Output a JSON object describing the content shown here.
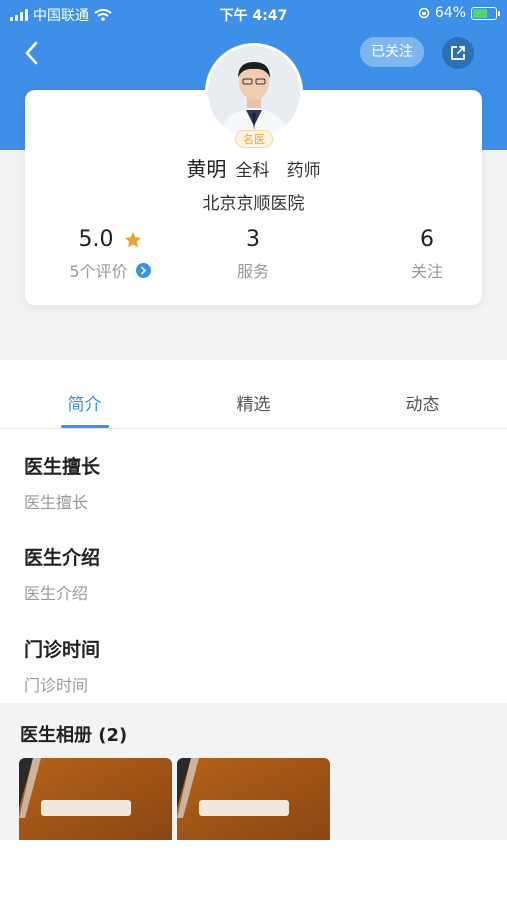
{
  "status_bar": {
    "carrier": "中国联通",
    "time": "下午 4:47",
    "battery_percent": "64%",
    "battery_level": 0.64
  },
  "header": {
    "follow_button": "已关注"
  },
  "doctor": {
    "badge": "名医",
    "name": "黄明",
    "department": "全科",
    "title": "药师",
    "hospital": "北京京顺医院"
  },
  "stats": {
    "rating_value": "5.0",
    "rating_label": "5个评价",
    "service_value": "3",
    "service_label": "服务",
    "follow_value": "6",
    "follow_label": "关注"
  },
  "tabs": [
    "简介",
    "精选",
    "动态"
  ],
  "sections": {
    "specialty_title": "医生擅长",
    "specialty_text": "医生擅长",
    "intro_title": "医生介绍",
    "intro_text": "医生介绍",
    "schedule_title": "门诊时间",
    "schedule_text": "门诊时间"
  },
  "album": {
    "title": "医生相册 (2)"
  },
  "colors": {
    "accent": "#3d8fe8",
    "star": "#f0a030",
    "battery": "#4cd964"
  },
  "icons": [
    "back-arrow-icon",
    "share-icon",
    "star-icon",
    "chevron-right-icon",
    "wifi-icon",
    "signal-icon",
    "battery-icon",
    "orientation-lock-icon"
  ]
}
